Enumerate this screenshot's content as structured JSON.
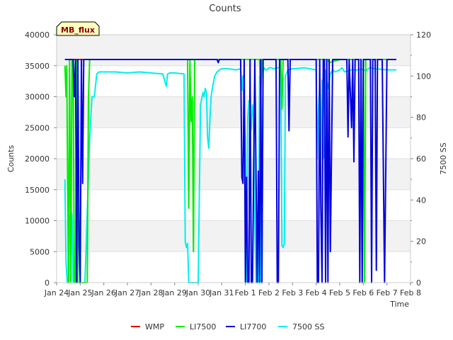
{
  "chart_data": {
    "type": "line",
    "title": "Counts",
    "badge": "MB_flux",
    "xlabel": "Time",
    "ylabel": "Counts",
    "y2label": "7500 SS",
    "xlim": [
      0,
      15
    ],
    "ylim": [
      0,
      40000
    ],
    "y2lim": [
      0,
      120
    ],
    "x_ticks": [
      {
        "v": 0,
        "label": "Jan 24"
      },
      {
        "v": 1,
        "label": "Jan 25"
      },
      {
        "v": 2,
        "label": "Jan 26"
      },
      {
        "v": 3,
        "label": "Jan 27"
      },
      {
        "v": 4,
        "label": "Jan 28"
      },
      {
        "v": 5,
        "label": "Jan 29"
      },
      {
        "v": 6,
        "label": "Jan 30"
      },
      {
        "v": 7,
        "label": "Jan 31"
      },
      {
        "v": 8,
        "label": "Feb 1"
      },
      {
        "v": 9,
        "label": "Feb 2"
      },
      {
        "v": 10,
        "label": "Feb 3"
      },
      {
        "v": 11,
        "label": "Feb 4"
      },
      {
        "v": 12,
        "label": "Feb 5"
      },
      {
        "v": 13,
        "label": "Feb 6"
      },
      {
        "v": 14,
        "label": "Feb 7"
      },
      {
        "v": 15,
        "label": "Feb 8"
      }
    ],
    "y_ticks": [
      0,
      5000,
      10000,
      15000,
      20000,
      25000,
      30000,
      35000,
      40000
    ],
    "y2_ticks": [
      0,
      20,
      40,
      60,
      80,
      100,
      120
    ],
    "grid": true,
    "legend_position": "bottom",
    "series": [
      {
        "name": "WMP",
        "color": "#dd0000",
        "axis": "left",
        "x": [
          0.35,
          1.0,
          1.45
        ],
        "y": [
          36000,
          36000,
          36000
        ]
      },
      {
        "name": "LI7500",
        "color": "#00ee00",
        "axis": "left",
        "x": [
          0.35,
          0.4,
          0.43,
          0.46,
          0.5,
          0.55,
          0.6,
          0.65,
          0.7,
          0.75,
          0.8,
          0.85,
          0.9,
          0.95,
          1.0,
          1.1,
          1.2,
          1.3,
          1.35,
          1.4,
          1.45,
          1.6,
          3.0,
          5.0,
          5.55,
          5.6,
          5.65,
          5.7,
          5.75,
          5.8,
          5.85,
          5.9,
          5.95,
          6.0,
          6.05,
          6.1,
          6.2,
          7.0,
          8.0,
          8.6,
          8.65,
          8.7,
          9.0,
          9.5,
          9.55,
          9.6,
          9.65,
          10.0,
          11.0,
          11.5,
          11.55,
          12.0,
          12.9,
          12.95,
          13.0,
          13.05,
          13.1,
          13.2,
          14.0,
          14.4
        ],
        "y": [
          35000,
          30000,
          35000,
          20000,
          0,
          36000,
          0,
          36000,
          36000,
          0,
          0,
          36000,
          0,
          0,
          0,
          0,
          0,
          0,
          30000,
          36000,
          36000,
          36000,
          36000,
          36000,
          36000,
          12000,
          36000,
          26000,
          30000,
          5000,
          36000,
          36000,
          36000,
          36000,
          36000,
          36000,
          36000,
          36000,
          36000,
          36000,
          30000,
          36000,
          36000,
          36000,
          28000,
          36000,
          36000,
          36000,
          36000,
          36000,
          35500,
          36000,
          36000,
          0,
          36000,
          0,
          36000,
          36000,
          36000,
          36000
        ]
      },
      {
        "name": "LI7700",
        "color": "#0000dd",
        "axis": "left",
        "x": [
          0.35,
          0.7,
          0.75,
          0.8,
          0.85,
          0.9,
          0.95,
          1.0,
          1.05,
          1.1,
          1.15,
          1.2,
          1.25,
          1.3,
          1.35,
          1.4,
          1.5,
          3.0,
          4.5,
          5.0,
          6.5,
          6.8,
          6.85,
          6.9,
          7.0,
          7.8,
          7.85,
          7.9,
          7.95,
          8.0,
          8.05,
          8.1,
          8.15,
          8.2,
          8.25,
          8.3,
          8.4,
          8.5,
          8.55,
          8.6,
          8.65,
          8.7,
          8.75,
          8.8,
          8.9,
          9.3,
          9.35,
          9.4,
          9.45,
          9.8,
          9.85,
          9.9,
          10.5,
          11.0,
          11.05,
          11.1,
          11.15,
          11.2,
          11.25,
          11.3,
          11.35,
          11.4,
          11.45,
          11.5,
          11.55,
          11.6,
          11.7,
          11.8,
          11.85,
          11.9,
          12.0,
          12.3,
          12.35,
          12.4,
          12.5,
          12.55,
          12.6,
          12.65,
          12.7,
          12.8,
          12.85,
          12.9,
          12.95,
          13.0,
          13.05,
          13.1,
          13.2,
          13.3,
          13.35,
          13.4,
          13.5,
          13.55,
          13.6,
          13.65,
          13.7,
          13.8,
          13.9,
          14.0,
          14.2,
          14.4
        ],
        "y": [
          36000,
          36000,
          30000,
          36000,
          0,
          36000,
          6000,
          0,
          36000,
          16000,
          36000,
          36000,
          36000,
          36000,
          36000,
          36000,
          36000,
          36000,
          36000,
          36000,
          36000,
          36000,
          35500,
          36000,
          36000,
          36000,
          17000,
          16000,
          36000,
          0,
          17000,
          0,
          0,
          36000,
          0,
          0,
          36000,
          0,
          18000,
          0,
          36000,
          0,
          36000,
          36000,
          36000,
          36000,
          0,
          0,
          36000,
          36000,
          24500,
          36000,
          36000,
          36000,
          0,
          0,
          36000,
          12000,
          0,
          36000,
          36000,
          0,
          36000,
          0,
          36000,
          5000,
          36000,
          36000,
          36000,
          36000,
          36000,
          36000,
          23500,
          36000,
          25000,
          36000,
          19500,
          36000,
          36000,
          36000,
          0,
          36000,
          0,
          36000,
          36000,
          36000,
          36000,
          36000,
          0,
          36000,
          36000,
          2000,
          36000,
          36000,
          36000,
          36000,
          0,
          36000,
          36000,
          36000
        ]
      },
      {
        "name": "7500 SS",
        "color": "#00eeee",
        "axis": "right",
        "x": [
          0.35,
          0.4,
          0.45,
          0.5,
          0.55,
          0.6,
          0.65,
          0.7,
          0.75,
          0.8,
          0.9,
          1.0,
          1.2,
          1.4,
          1.5,
          1.6,
          1.7,
          1.8,
          2.0,
          2.5,
          3.0,
          3.5,
          4.0,
          4.5,
          4.6,
          4.65,
          4.7,
          4.8,
          5.0,
          5.4,
          5.45,
          5.5,
          5.55,
          5.6,
          5.62,
          5.7,
          5.8,
          6.0,
          6.1,
          6.2,
          6.25,
          6.3,
          6.35,
          6.4,
          6.45,
          6.5,
          6.55,
          6.6,
          6.7,
          6.8,
          6.9,
          7.0,
          7.3,
          7.6,
          7.8,
          7.85,
          7.9,
          8.0,
          8.05,
          8.1,
          8.15,
          8.2,
          8.25,
          8.3,
          8.35,
          8.4,
          8.45,
          8.5,
          8.55,
          8.6,
          8.65,
          8.7,
          8.75,
          8.8,
          8.85,
          8.9,
          9.0,
          9.1,
          9.2,
          9.3,
          9.4,
          9.5,
          9.55,
          9.6,
          9.65,
          9.7,
          9.8,
          10.0,
          10.5,
          11.0,
          11.05,
          11.1,
          11.15,
          11.2,
          11.25,
          11.3,
          11.35,
          11.4,
          11.45,
          11.5,
          11.6,
          11.7,
          11.8,
          11.9,
          12.0,
          12.1,
          12.2,
          12.5,
          12.6,
          12.7,
          12.8,
          12.9,
          13.0,
          13.1,
          13.2,
          13.3,
          13.5,
          14.0,
          14.4
        ],
        "y": [
          50,
          10,
          0,
          0,
          30,
          35,
          33,
          0,
          0,
          0,
          0,
          0,
          0,
          70,
          90,
          90,
          101,
          102,
          102,
          102,
          101.5,
          102,
          101.5,
          101,
          97,
          95,
          101,
          101.5,
          101.5,
          101,
          20,
          17,
          19,
          0,
          0,
          0,
          0,
          0,
          86,
          92,
          90,
          94,
          92,
          70,
          65,
          80,
          90,
          94,
          100,
          102,
          103,
          103.5,
          103.5,
          103,
          103.5,
          93,
          100,
          70,
          0,
          80,
          88,
          72,
          75,
          86,
          80,
          30,
          0,
          0,
          0,
          100,
          0,
          0,
          102,
          104,
          103,
          103,
          104,
          104,
          103.5,
          104,
          104,
          104,
          18,
          17,
          19,
          100,
          103,
          103.5,
          104,
          103,
          60,
          85,
          94,
          60,
          98,
          60,
          62,
          103,
          97,
          94,
          101,
          103,
          102,
          102.5,
          103,
          104,
          102,
          103,
          103,
          103,
          103,
          103.5,
          103,
          102.5,
          103.5,
          104,
          103.5,
          103,
          103
        ]
      }
    ]
  }
}
